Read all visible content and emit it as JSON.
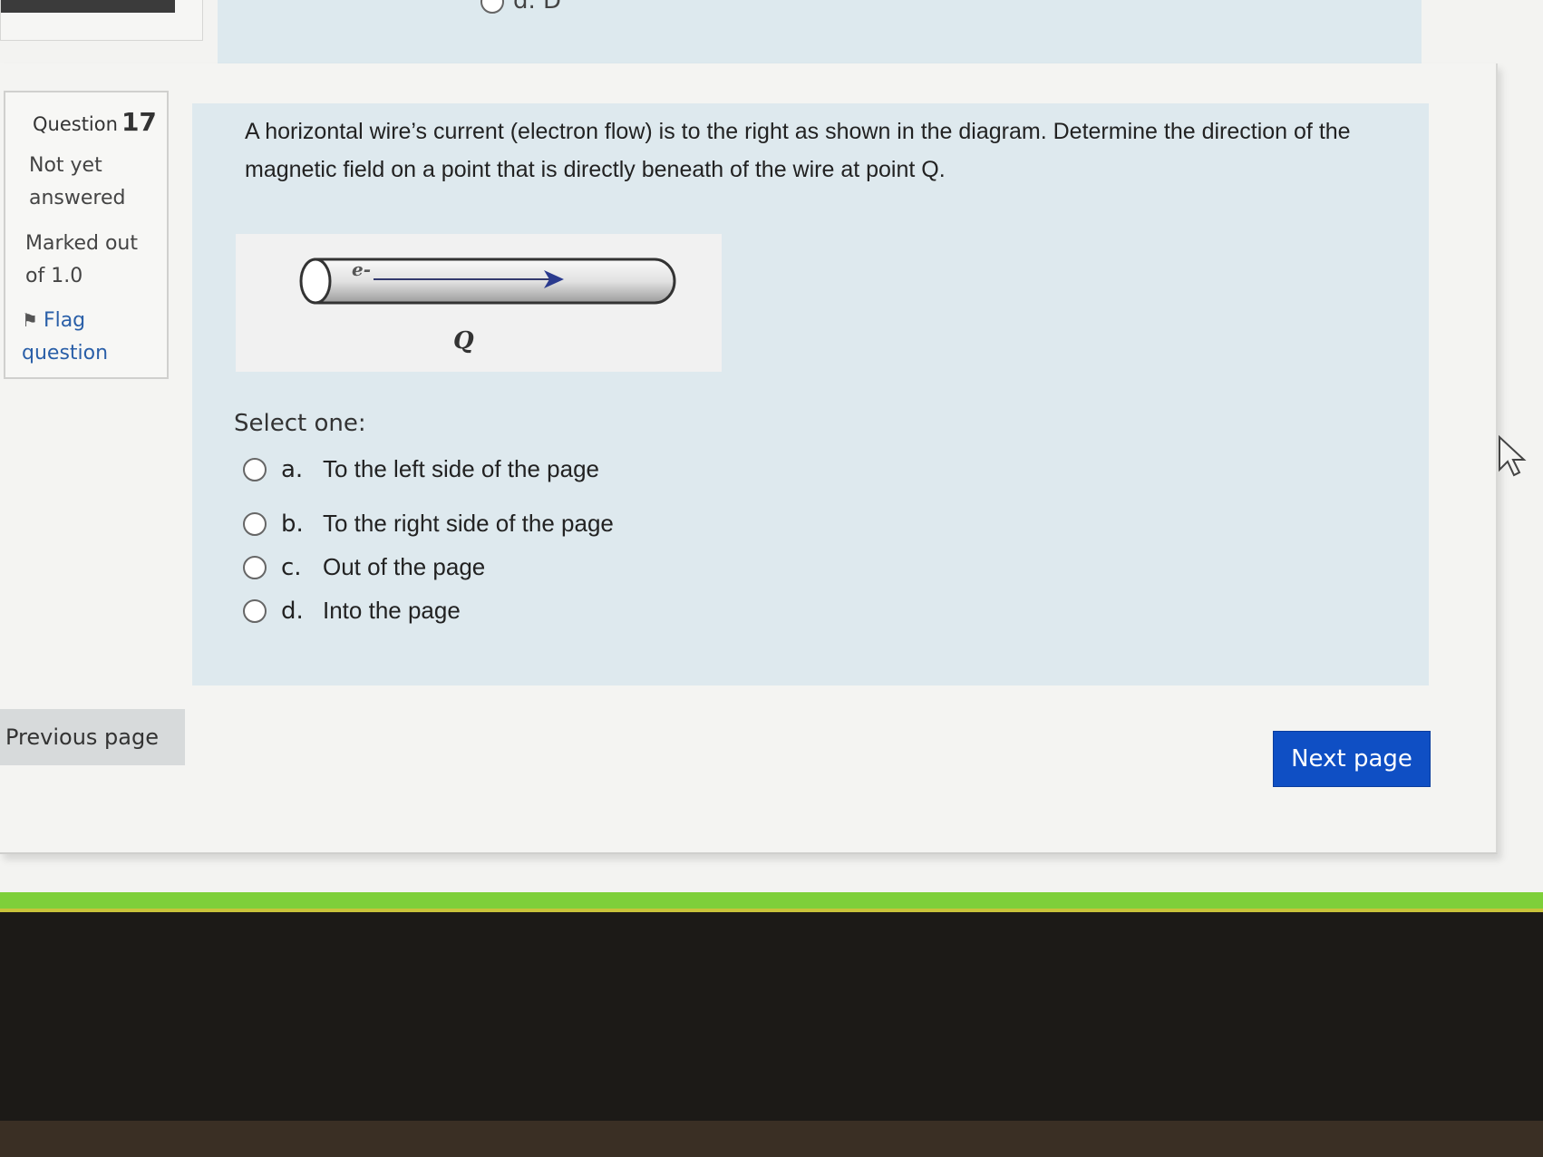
{
  "prev_question": {
    "visible_option": "d. D"
  },
  "info": {
    "question_label": "Question",
    "question_number": "17",
    "state": "Not yet answered",
    "marks": "Marked out of 1.0",
    "flag_label": "Flag question"
  },
  "question": {
    "text": "A horizontal wire’s current (electron flow) is to the right as shown in the diagram. Determine the direction of the magnetic field on a point that is directly beneath of the wire at point Q.",
    "diagram": {
      "electron_label": "e-",
      "point_label": "Q"
    },
    "select_one": "Select one:",
    "options": [
      {
        "letter": "a.",
        "text": "To the left side of the page"
      },
      {
        "letter": "b.",
        "text": "To the right side of the page"
      },
      {
        "letter": "c.",
        "text": "Out of the page"
      },
      {
        "letter": "d.",
        "text": "Into the page"
      }
    ]
  },
  "nav": {
    "previous": "Previous page",
    "next": "Next page"
  },
  "colors": {
    "next_button": "#0f4fc4",
    "question_bg": "#dee9ee",
    "flag_link": "#2a5fa8"
  }
}
